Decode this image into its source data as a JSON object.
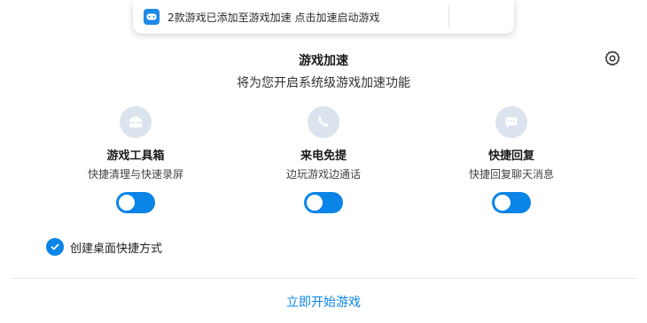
{
  "notification": {
    "icon": "game-controller-icon",
    "text": "2款游戏已添加至游戏加速  点击加速启动游戏"
  },
  "header": {
    "title": "游戏加速",
    "subtitle": "将为您开启系统级游戏加速功能",
    "settings_icon": "gear-icon"
  },
  "features": [
    {
      "icon": "toolbox-icon",
      "name": "游戏工具箱",
      "desc": "快捷清理与快速录屏",
      "enabled": true
    },
    {
      "icon": "phone-icon",
      "name": "来电免提",
      "desc": "边玩游戏边通话",
      "enabled": true
    },
    {
      "icon": "chat-bubble-icon",
      "name": "快捷回复",
      "desc": "快捷回复聊天消息",
      "enabled": true
    }
  ],
  "shortcut_option": {
    "label": "创建桌面快捷方式",
    "checked": true
  },
  "footer": {
    "start_label": "立即开始游戏"
  },
  "colors": {
    "accent": "#0a84e6",
    "icon_bg": "#dbe3ee",
    "icon_fg": "#ffffff"
  }
}
